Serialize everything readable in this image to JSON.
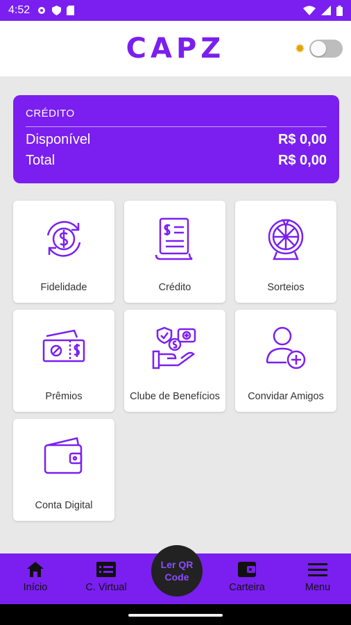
{
  "status_bar": {
    "time": "4:52"
  },
  "header": {
    "logo_text": "CAPZ",
    "theme_icon": "sun-icon"
  },
  "credit": {
    "title": "CRÉDITO",
    "rows": [
      {
        "label": "Disponível",
        "amount": "R$ 0,00"
      },
      {
        "label": "Total",
        "amount": "R$ 0,00"
      }
    ]
  },
  "tiles": [
    {
      "label": "Fidelidade",
      "icon": "dollar-refresh-icon"
    },
    {
      "label": "Crédito",
      "icon": "receipt-icon"
    },
    {
      "label": "Sorteios",
      "icon": "prize-wheel-icon"
    },
    {
      "label": "Prêmios",
      "icon": "tickets-icon"
    },
    {
      "label": "Clube de Benefícios",
      "icon": "benefits-hand-icon"
    },
    {
      "label": "Convidar Amigos",
      "icon": "add-user-icon"
    },
    {
      "label": "Conta Digital",
      "icon": "wallet-icon"
    }
  ],
  "bottom_nav": {
    "items": [
      {
        "label": "Início",
        "icon": "home-icon"
      },
      {
        "label": "C. Virtual",
        "icon": "card-icon"
      },
      {
        "label": "Carteira",
        "icon": "wallet-icon"
      },
      {
        "label": "Menu",
        "icon": "menu-icon"
      }
    ],
    "qr_label": "Ler QR Code"
  },
  "colors": {
    "primary": "#7a1ff0",
    "background": "#e8e8e8",
    "qr_button": "#222222"
  }
}
